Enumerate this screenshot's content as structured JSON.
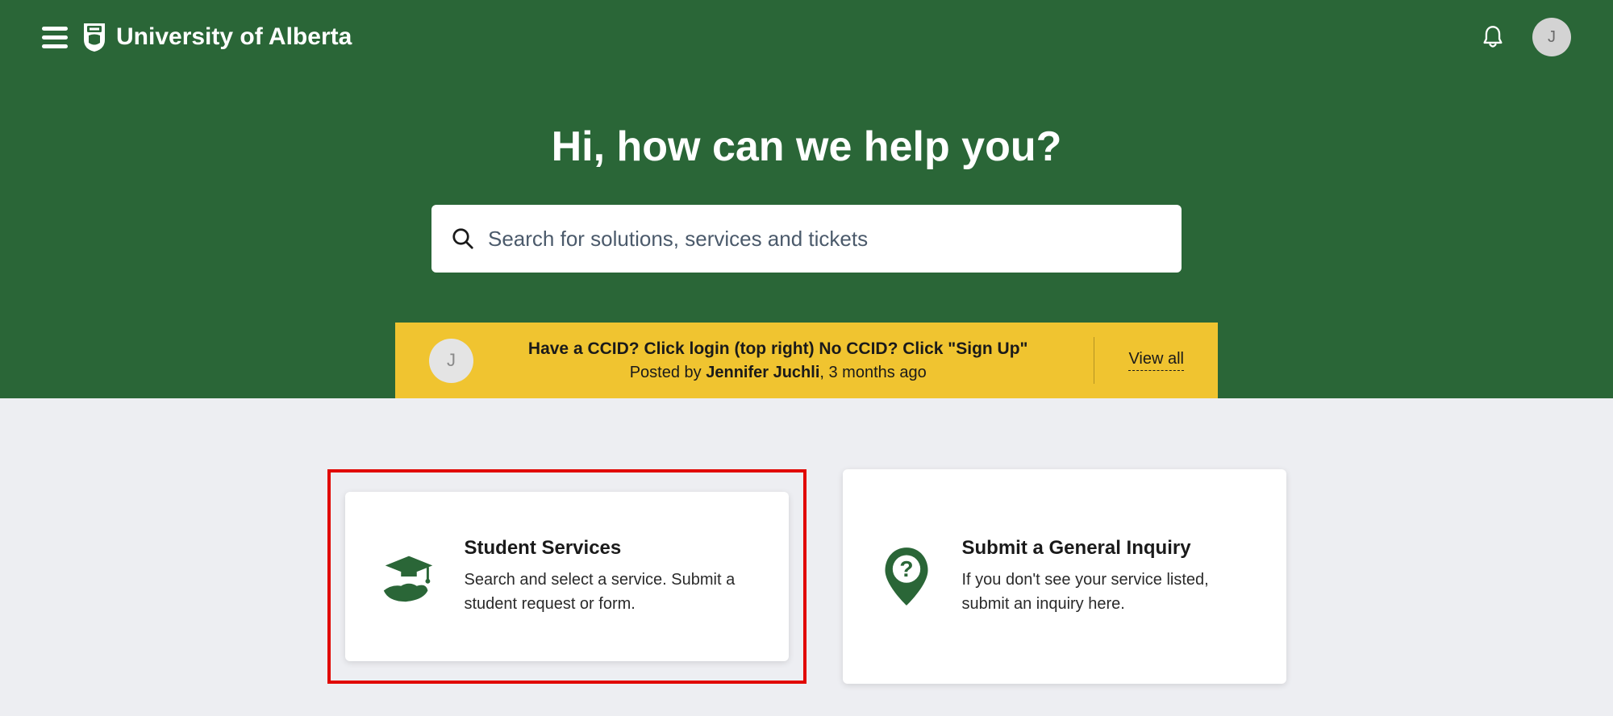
{
  "colors": {
    "brand_green": "#2a6637",
    "notice_yellow": "#f0c430",
    "highlight_red": "#e10600"
  },
  "header": {
    "site_title": "University of Alberta",
    "avatar_initial": "J"
  },
  "hero": {
    "heading": "Hi, how can we help you?",
    "search_placeholder": "Search for solutions, services and tickets"
  },
  "notice": {
    "avatar_initial": "J",
    "title": "Have a CCID? Click login (top right) No CCID? Click \"Sign Up\"",
    "posted_prefix": "Posted by ",
    "author": "Jennifer Juchli",
    "time_suffix": ", 3 months ago",
    "view_all_label": "View all"
  },
  "cards": [
    {
      "title": "Student Services",
      "description": "Search and select a service. Submit a student request or form.",
      "highlighted": true
    },
    {
      "title": "Submit a General Inquiry",
      "description": "If you don't see your service listed, submit an inquiry here.",
      "highlighted": false
    }
  ]
}
